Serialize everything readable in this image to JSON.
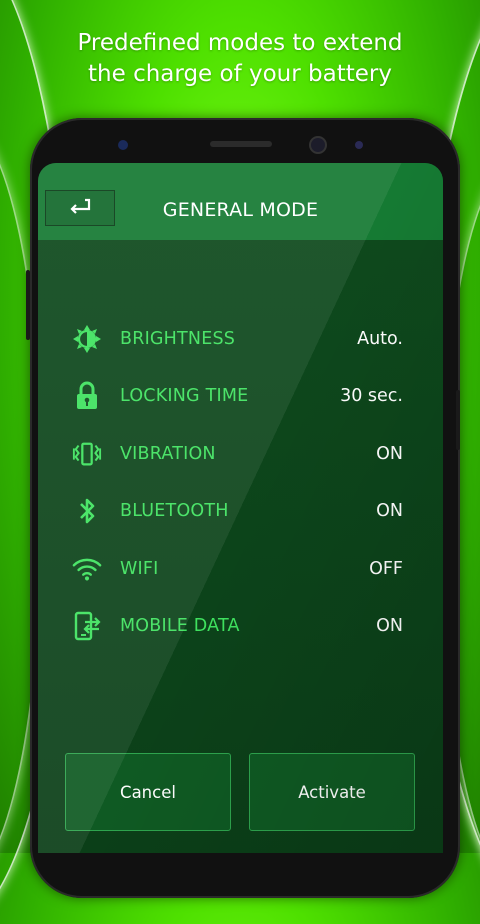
{
  "promo": {
    "line1": "Predefined modes to extend",
    "line2": "the charge of your battery"
  },
  "header": {
    "title": "GENERAL MODE",
    "back_icon": "back-arrow-icon"
  },
  "settings": [
    {
      "icon": "brightness-icon",
      "label": "BRIGHTNESS",
      "value": "Auto."
    },
    {
      "icon": "lock-icon",
      "label": "LOCKING TIME",
      "value": "30 sec."
    },
    {
      "icon": "vibration-icon",
      "label": "VIBRATION",
      "value": "ON"
    },
    {
      "icon": "bluetooth-icon",
      "label": "BLUETOOTH",
      "value": "ON"
    },
    {
      "icon": "wifi-icon",
      "label": "WIFI",
      "value": "OFF"
    },
    {
      "icon": "mobile-data-icon",
      "label": "MOBILE DATA",
      "value": "ON"
    }
  ],
  "actions": {
    "cancel": "Cancel",
    "activate": "Activate"
  },
  "colors": {
    "background": "#4ee000",
    "screen": "#0e4a1d",
    "appbar": "#157a33",
    "label_green": "#3fe25f",
    "value_white": "#ffffff"
  }
}
